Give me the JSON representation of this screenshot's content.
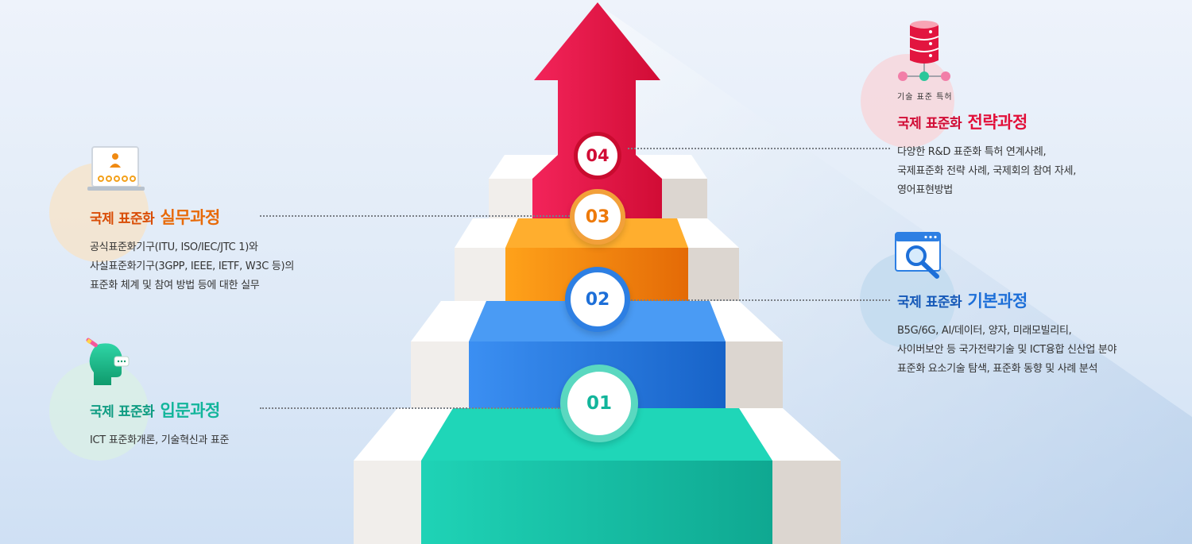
{
  "steps": [
    {
      "number": "01",
      "label": "국제 표준화",
      "highlight": "입문과정",
      "color": "#12b59b",
      "desc": "ICT  표준화개론, 기술혁신과 표준"
    },
    {
      "number": "02",
      "label": "국제 표준화",
      "highlight": "기본과정",
      "color": "#1d6fd8",
      "desc": "B5G/6G, AI/데이터, 양자, 미래모빌리티,\n사이버보안 등 국가전략기술 및 ICT융합 신산업 분야\n표준화 요소기술 탐색, 표준화 동향 및 사례 분석"
    },
    {
      "number": "03",
      "label": "국제 표준화",
      "highlight": "실무과정",
      "color": "#ee7a0a",
      "desc": "공식표준화기구(ITU, ISO/IEC/JTC 1)와\n사실표준화기구(3GPP, IEEE, IETF, W3C 등)의\n표준화 체계 및 참여 방법 등에 대한 실무"
    },
    {
      "number": "04",
      "label": "국제 표준화",
      "highlight": "전략과정",
      "color": "#e2103a",
      "tags": "기술 표준 특허",
      "desc": "다양한 R&D 표준화 특허 연계사례,\n국제표준화 전략 사례, 국제회의 참여 자세,\n영어표현방법"
    }
  ],
  "colors": {
    "intro": "#12b59b",
    "basic": "#1d6fd8",
    "practice": "#ee7a0a",
    "strategy": "#e2103a",
    "stair_face": "#f3f1ef",
    "stair_side": "#dedad5"
  },
  "icons": {
    "intro": "head-speech-icon",
    "basic": "browser-search-icon",
    "practice": "laptop-user-icon",
    "strategy": "database-network-icon"
  }
}
